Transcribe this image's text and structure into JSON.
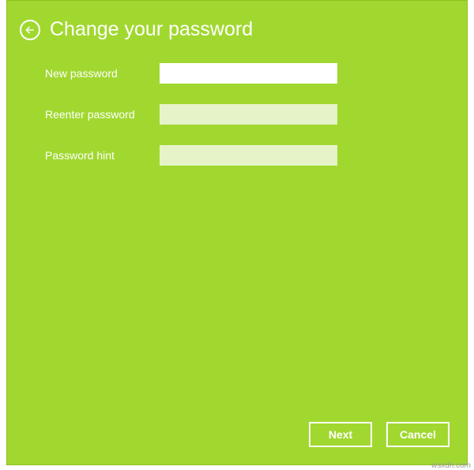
{
  "header": {
    "title": "Change your password"
  },
  "form": {
    "new_password": {
      "label": "New password",
      "value": ""
    },
    "reenter_password": {
      "label": "Reenter password",
      "value": ""
    },
    "password_hint": {
      "label": "Password hint",
      "value": ""
    }
  },
  "footer": {
    "next_label": "Next",
    "cancel_label": "Cancel"
  },
  "colors": {
    "panel_bg": "#a1d830",
    "text": "#ffffff",
    "field_active": "#ffffff",
    "field_inactive": "#e6f3c9"
  },
  "watermark": "wsxdn.com"
}
